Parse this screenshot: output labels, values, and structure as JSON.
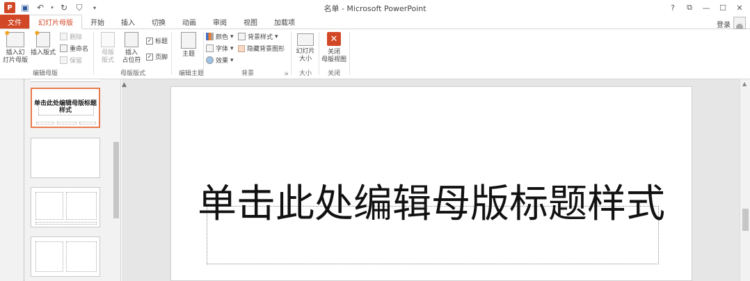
{
  "titlebar": {
    "title": "名单 - Microsoft PowerPoint",
    "app_badge": "P",
    "qat": {
      "save_icon": "save-icon",
      "undo_icon": "undo-icon",
      "redo_icon": "redo-icon",
      "customize_icon": "customize-icon"
    },
    "controls": [
      "?",
      "⧉",
      "—",
      "☐",
      "✕"
    ]
  },
  "tabs": [
    {
      "label": "文件"
    },
    {
      "label": "幻灯片母版"
    },
    {
      "label": "开始"
    },
    {
      "label": "插入"
    },
    {
      "label": "切换"
    },
    {
      "label": "动画"
    },
    {
      "label": "审阅"
    },
    {
      "label": "视图"
    },
    {
      "label": "加载项"
    }
  ],
  "account": {
    "login": "登录"
  },
  "ribbon": {
    "edit_master": {
      "label": "编辑母版",
      "insert_slide_master": "插入幻\n灯片母版",
      "insert_layout": "插入版式",
      "delete": "删除",
      "rename": "重命名",
      "preserve": "保留"
    },
    "master_layout": {
      "label": "母版版式",
      "master_layout_btn": "母版\n版式",
      "insert_placeholder": "插入\n占位符",
      "title_check": "标题",
      "footer_check": "页脚"
    },
    "edit_theme": {
      "label": "编辑主题",
      "themes": "主题"
    },
    "background": {
      "label": "背景",
      "colors": "颜色",
      "fonts": "字体",
      "effects": "效果",
      "background_styles": "背景样式",
      "hide_background": "隐藏背景图形"
    },
    "size": {
      "label": "大小",
      "slide_size": "幻灯片\n大小"
    },
    "close": {
      "label": "关闭",
      "close_master_view": "关闭\n母版视图"
    }
  },
  "thumbnails": {
    "selected_title": "单击此处编辑母版标题样式"
  },
  "slide": {
    "title_placeholder": "单击此处编辑母版标题样式"
  }
}
